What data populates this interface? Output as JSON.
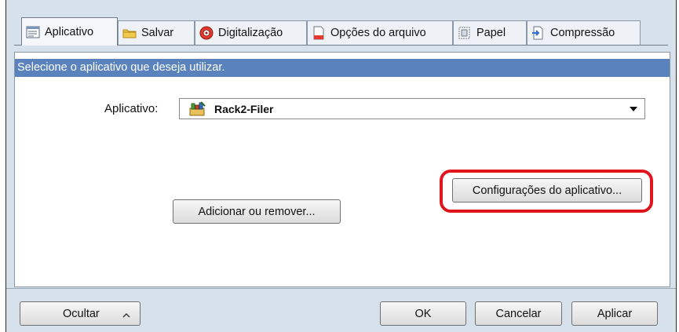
{
  "tabs": [
    {
      "label": "Aplicativo",
      "icon": "application-list-icon",
      "active": true
    },
    {
      "label": "Salvar",
      "icon": "folder-icon",
      "active": false
    },
    {
      "label": "Digitalização",
      "icon": "scan-disc-icon",
      "active": false
    },
    {
      "label": "Opções do arquivo",
      "icon": "file-options-icon",
      "active": false
    },
    {
      "label": "Papel",
      "icon": "paper-icon",
      "active": false
    },
    {
      "label": "Compressão",
      "icon": "compression-icon",
      "active": false
    }
  ],
  "panel": {
    "hint": "Selecione o aplicativo que deseja utilizar.",
    "application_label": "Aplicativo:",
    "application_selected": "Rack2-Filer",
    "application_icon": "rack2-filer-app-icon",
    "app_settings_button": "Configurações do aplicativo...",
    "add_remove_button": "Adicionar ou remover..."
  },
  "highlight": {
    "color": "#e0141b"
  },
  "footer": {
    "hide_button": "Ocultar",
    "ok_button": "OK",
    "cancel_button": "Cancelar",
    "apply_button": "Aplicar"
  },
  "colors": {
    "hint_bar": "#5a83bd",
    "window_bg": "#d7e1ec"
  }
}
